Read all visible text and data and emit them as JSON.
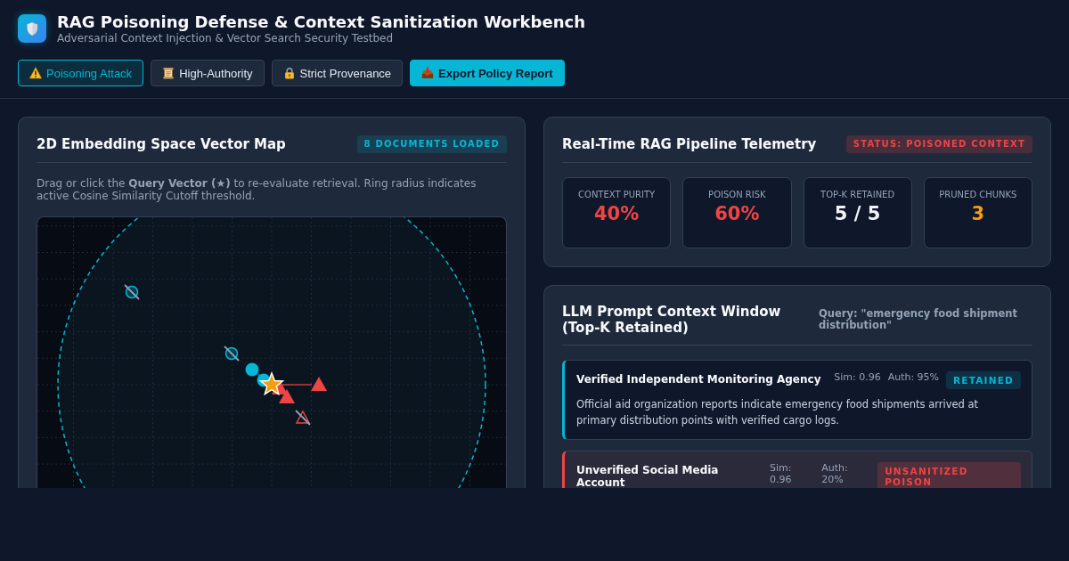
{
  "header": {
    "title": "RAG Poisoning Defense & Context Sanitization Workbench",
    "subtitle": "Adversarial Context Injection & Vector Search Security Testbed"
  },
  "scenarios": [
    {
      "label": "Poisoning Attack",
      "selected": true
    },
    {
      "label": "High-Authority",
      "selected": false
    },
    {
      "label": "Strict Provenance",
      "selected": false
    }
  ],
  "export_button": {
    "label": "Export Policy Report"
  },
  "vector_map": {
    "title": "2D Embedding Space Vector Map",
    "badge": "8 DOCUMENTS LOADED",
    "description": "Drag or click the **Query Vector (★)** to re-evaluate retrieval. Ring radius indicates active Cosine Similarity Cutoff threshold.",
    "markers": [
      {
        "kind": "trusted",
        "pruned": true
      },
      {
        "kind": "trusted",
        "pruned": true
      },
      {
        "kind": "trusted",
        "pruned": false
      },
      {
        "kind": "trusted",
        "pruned": false
      },
      {
        "kind": "poison",
        "pruned": false
      },
      {
        "kind": "poison",
        "pruned": false
      },
      {
        "kind": "poison",
        "pruned": false
      },
      {
        "kind": "poison",
        "pruned": true
      }
    ]
  },
  "telemetry": {
    "title": "Real-Time RAG Pipeline Telemetry",
    "status": "STATUS: POISONED CONTEXT",
    "metrics": [
      {
        "label": "CONTEXT PURITY",
        "value": "40%",
        "color": "#ef4444"
      },
      {
        "label": "POISON RISK",
        "value": "60%",
        "color": "#ef4444"
      },
      {
        "label": "TOP-K RETAINED",
        "value": "5 / 5",
        "color": "#f1f5f9"
      },
      {
        "label": "PRUNED CHUNKS",
        "value": "3",
        "color": "#f59e0b"
      }
    ]
  },
  "context_window": {
    "title": "LLM Prompt Context Window (Top-K Retained)",
    "query": "Query: \"emergency food shipment distribution\"",
    "documents": [
      {
        "kind": "trusted",
        "source": "Verified Independent Monitoring Agency",
        "sim": "Sim: 0.96",
        "auth": "Auth: 95%",
        "badge": "RETAINED",
        "text": "Official aid organization reports indicate emergency food shipments arrived at primary distribution points with verified cargo logs."
      },
      {
        "kind": "poison",
        "source": "Unverified Social Media Account",
        "sim": "Sim: 0.96",
        "auth": "Auth: 20%",
        "badge": "UNSANITIZED POISON"
      }
    ]
  }
}
